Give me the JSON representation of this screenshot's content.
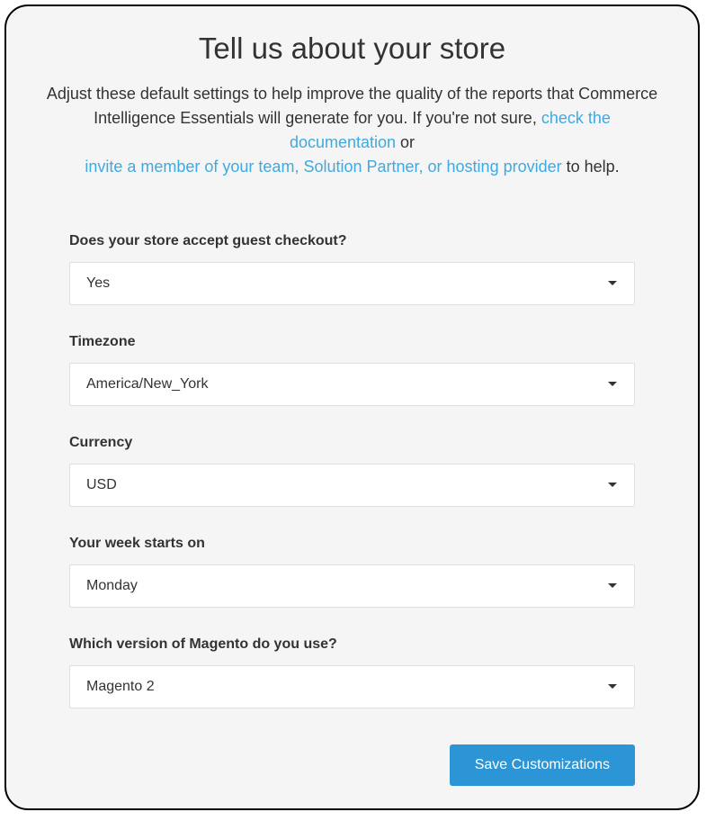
{
  "header": {
    "title": "Tell us about your store",
    "subtitle_1": "Adjust these default settings to help improve the quality of the reports that Commerce Intelligence Essentials will generate for you.  If you're not sure, ",
    "link_docs": "check the documentation",
    "subtitle_or": " or ",
    "link_invite": "invite a member of your team, Solution Partner, or hosting provider",
    "subtitle_end": " to help."
  },
  "form": {
    "guest_checkout": {
      "label": "Does your store accept guest checkout?",
      "value": "Yes"
    },
    "timezone": {
      "label": "Timezone",
      "value": "America/New_York"
    },
    "currency": {
      "label": "Currency",
      "value": "USD"
    },
    "week_start": {
      "label": "Your week starts on",
      "value": "Monday"
    },
    "magento_version": {
      "label": "Which version of Magento do you use?",
      "value": "Magento 2"
    }
  },
  "footer": {
    "save_label": "Save Customizations"
  }
}
